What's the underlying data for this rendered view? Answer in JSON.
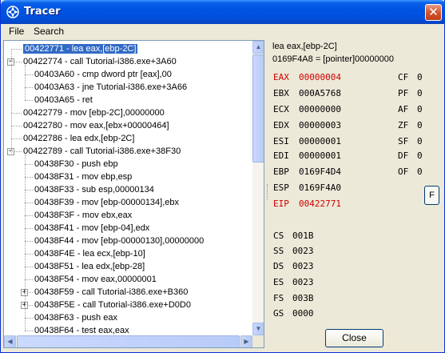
{
  "window": {
    "title": "Tracer",
    "close_glyph": "✕",
    "app_icon": "tracer-app-icon"
  },
  "menu": [
    {
      "label": "File"
    },
    {
      "label": "Search"
    }
  ],
  "tree": [
    {
      "text": "00422771 - lea eax,[ebp-2C]",
      "depth": 0,
      "expander": "",
      "selected": true
    },
    {
      "text": "00422774 - call Tutorial-i386.exe+3A60",
      "depth": 0,
      "expander": "−",
      "selected": false
    },
    {
      "text": "00403A60 - cmp dword ptr [eax],00",
      "depth": 1,
      "expander": "",
      "selected": false
    },
    {
      "text": "00403A63 - jne Tutorial-i386.exe+3A66",
      "depth": 1,
      "expander": "",
      "selected": false
    },
    {
      "text": "00403A65 - ret",
      "depth": 1,
      "expander": "",
      "selected": false
    },
    {
      "text": "00422779 - mov [ebp-2C],00000000",
      "depth": 0,
      "expander": "",
      "selected": false
    },
    {
      "text": "00422780 - mov eax,[ebx+00000464]",
      "depth": 0,
      "expander": "",
      "selected": false
    },
    {
      "text": "00422786 - lea edx,[ebp-2C]",
      "depth": 0,
      "expander": "",
      "selected": false
    },
    {
      "text": "00422789 - call Tutorial-i386.exe+38F30",
      "depth": 0,
      "expander": "−",
      "selected": false
    },
    {
      "text": "00438F30 - push ebp",
      "depth": 1,
      "expander": "",
      "selected": false
    },
    {
      "text": "00438F31 - mov ebp,esp",
      "depth": 1,
      "expander": "",
      "selected": false
    },
    {
      "text": "00438F33 - sub esp,00000134",
      "depth": 1,
      "expander": "",
      "selected": false
    },
    {
      "text": "00438F39 - mov [ebp-00000134],ebx",
      "depth": 1,
      "expander": "",
      "selected": false
    },
    {
      "text": "00438F3F - mov ebx,eax",
      "depth": 1,
      "expander": "",
      "selected": false
    },
    {
      "text": "00438F41 - mov [ebp-04],edx",
      "depth": 1,
      "expander": "",
      "selected": false
    },
    {
      "text": "00438F44 - mov [ebp-00000130],00000000",
      "depth": 1,
      "expander": "",
      "selected": false
    },
    {
      "text": "00438F4E - lea ecx,[ebp-10]",
      "depth": 1,
      "expander": "",
      "selected": false
    },
    {
      "text": "00438F51 - lea edx,[ebp-28]",
      "depth": 1,
      "expander": "",
      "selected": false
    },
    {
      "text": "00438F54 - mov eax,00000001",
      "depth": 1,
      "expander": "",
      "selected": false
    },
    {
      "text": "00438F59 - call Tutorial-i386.exe+B360",
      "depth": 1,
      "expander": "+",
      "selected": false
    },
    {
      "text": "00438F5E - call Tutorial-i386.exe+D0D0",
      "depth": 1,
      "expander": "+",
      "selected": false
    },
    {
      "text": "00438F63 - push eax",
      "depth": 1,
      "expander": "",
      "selected": false
    },
    {
      "text": "00438F64 - test eax,eax",
      "depth": 1,
      "expander": "",
      "selected": false
    }
  ],
  "info": {
    "instruction": "lea eax,[ebp-2C]",
    "pointer_line": "0169F4A8 = [pointer]00000000"
  },
  "registers": [
    {
      "name": "EAX",
      "value": "00000004",
      "changed": true
    },
    {
      "name": "EBX",
      "value": "000A5768",
      "changed": false
    },
    {
      "name": "ECX",
      "value": "00000000",
      "changed": false
    },
    {
      "name": "EDX",
      "value": "00000003",
      "changed": false
    },
    {
      "name": "ESI",
      "value": "00000001",
      "changed": false
    },
    {
      "name": "EDI",
      "value": "00000001",
      "changed": false
    },
    {
      "name": "EBP",
      "value": "0169F4D4",
      "changed": false
    },
    {
      "name": "ESP",
      "value": "0169F4A0",
      "changed": false
    },
    {
      "name": "EIP",
      "value": "00422771",
      "changed": true
    }
  ],
  "flags": [
    {
      "name": "CF",
      "value": "0"
    },
    {
      "name": "PF",
      "value": "0"
    },
    {
      "name": "AF",
      "value": "0"
    },
    {
      "name": "ZF",
      "value": "0"
    },
    {
      "name": "SF",
      "value": "0"
    },
    {
      "name": "DF",
      "value": "0"
    },
    {
      "name": "OF",
      "value": "0"
    }
  ],
  "segments": [
    {
      "name": "CS",
      "value": "001B"
    },
    {
      "name": "SS",
      "value": "0023"
    },
    {
      "name": "DS",
      "value": "0023"
    },
    {
      "name": "ES",
      "value": "0023"
    },
    {
      "name": "FS",
      "value": "003B"
    },
    {
      "name": "GS",
      "value": "0000"
    }
  ],
  "buttons": {
    "float_label": "F",
    "close_label": "Close"
  },
  "colors": {
    "changed_register": "#d00000",
    "selection": "#316ac5",
    "titlebar": "#0054e3"
  }
}
